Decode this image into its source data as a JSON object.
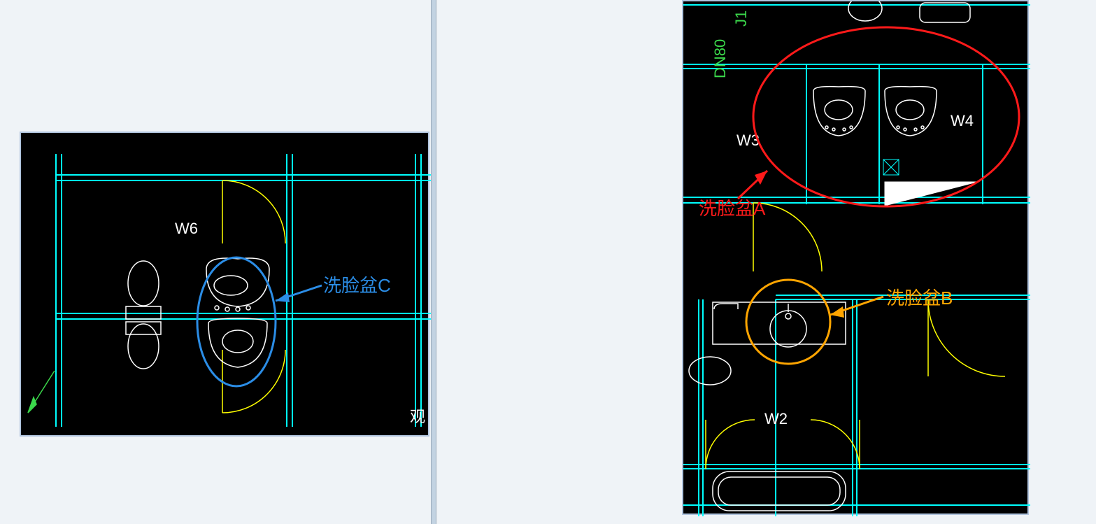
{
  "left_panel": {
    "rooms": {
      "w6": "W6",
      "misc": "观"
    },
    "annotation_c": "洗脸盆C"
  },
  "right_panel": {
    "labels": {
      "dn": "DN80",
      "j1": "J1",
      "w3": "W3",
      "w4": "W4",
      "w2": "W2"
    },
    "annotation_a": "洗脸盆A",
    "annotation_b": "洗脸盆B"
  },
  "colors": {
    "cyan": "#00ffff",
    "yellow": "#ffff00",
    "green": "#3bd84b",
    "white": "#ffffff",
    "blue": "#2b8de6",
    "red": "#ff1a1a",
    "orange": "#ffa500"
  }
}
